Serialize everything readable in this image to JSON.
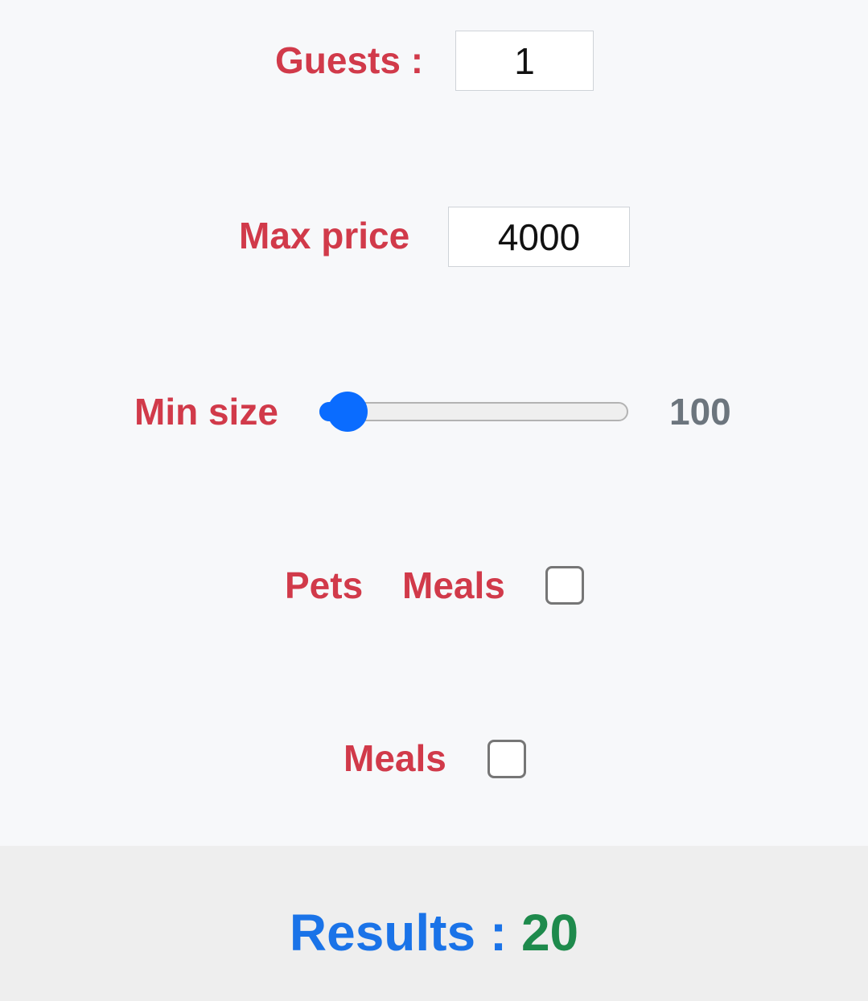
{
  "guests": {
    "label": "Guests :",
    "value": "1"
  },
  "max_price": {
    "label": "Max price",
    "value": "4000"
  },
  "min_size": {
    "label": "Min size",
    "value": "100",
    "slider_fraction": 0.03
  },
  "pets_meals_row": {
    "pets_label": "Pets",
    "meals_label": "Meals",
    "checked": false
  },
  "meals_row": {
    "meals_label": "Meals",
    "checked": false
  },
  "results": {
    "label": "Results :",
    "count": "20"
  },
  "colors": {
    "label": "#d13a4a",
    "slider_thumb": "#0a6cff",
    "results_label": "#1a73e8",
    "results_count": "#1e8a4c"
  }
}
